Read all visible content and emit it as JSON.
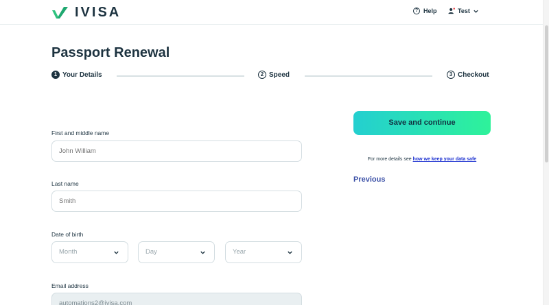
{
  "header": {
    "brand": "IVISA",
    "help_label": "Help",
    "user_label": "Test"
  },
  "page": {
    "title": "Passport Renewal"
  },
  "steps": [
    {
      "number": "1",
      "label": "Your Details",
      "active": true
    },
    {
      "number": "2",
      "label": "Speed",
      "active": false
    },
    {
      "number": "3",
      "label": "Checkout",
      "active": false
    }
  ],
  "form": {
    "first_name": {
      "label": "First and middle name",
      "placeholder": "John William",
      "value": ""
    },
    "last_name": {
      "label": "Last name",
      "placeholder": "Smith",
      "value": ""
    },
    "dob": {
      "label": "Date of birth",
      "month_placeholder": "Month",
      "day_placeholder": "Day",
      "year_placeholder": "Year"
    },
    "email": {
      "label": "Email address",
      "value": "automations2@ivisa.com"
    }
  },
  "actions": {
    "save_continue": "Save and continue",
    "safety_text": "For more details see ",
    "safety_link": "how we keep your data safe",
    "previous": "Previous"
  },
  "colors": {
    "brand_green": "#2ec27e",
    "cta_gradient_start": "#24cfd0",
    "cta_gradient_end": "#2ef29a",
    "link_blue": "#1a2fd0",
    "previous_blue": "#3a4fa6",
    "text_dark": "#1d3340"
  },
  "icons": {
    "logo": "ivisa-check-logo-icon",
    "help": "help-circle-icon",
    "user": "user-icon",
    "dropdown": "chevron-down-icon"
  }
}
